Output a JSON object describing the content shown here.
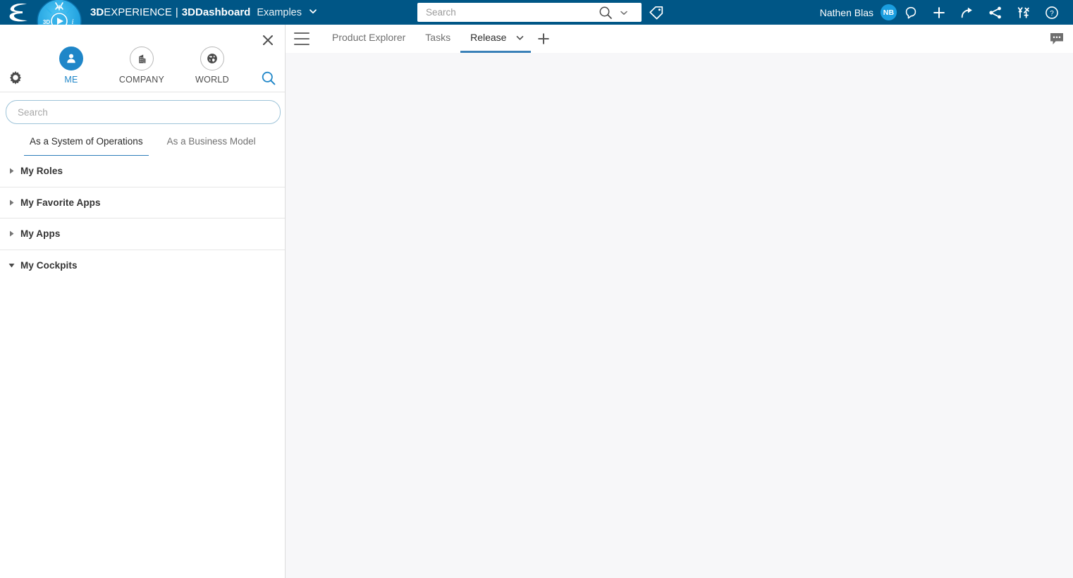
{
  "header": {
    "brand_bold_1": "3D",
    "brand_reg_1": "EXPERIENCE",
    "separator": "|",
    "brand_bold_2": "3DD",
    "brand_reg_2": "ashboard",
    "dashboard_name": "Examples",
    "dashboard_caret": "chevron-down-icon",
    "search": {
      "placeholder": "Search",
      "value": "",
      "magnifier_icon": "search-icon",
      "caret_icon": "chevron-down-icon"
    },
    "tag_icon": "tag-icon",
    "user_name": "Nathen Blas",
    "avatar_initials": "NB",
    "icons": [
      {
        "name": "notification-icon",
        "label": "Notifications"
      },
      {
        "name": "add-icon",
        "label": "Add"
      },
      {
        "name": "share-arrow-icon",
        "label": "Share"
      },
      {
        "name": "share-network-icon",
        "label": "Collaborate"
      },
      {
        "name": "swym-icon",
        "label": "3DSwym"
      },
      {
        "name": "help-icon",
        "label": "Help"
      }
    ],
    "bg_color": "#005686",
    "avatar_color": "#1a9ee0"
  },
  "left_panel": {
    "close_icon": "close-icon",
    "gear_icon": "gear-icon",
    "magnifier_icon": "search-icon",
    "segments": [
      {
        "label": "ME",
        "icon": "person-icon",
        "active": true
      },
      {
        "label": "COMPANY",
        "icon": "building-icon",
        "active": false
      },
      {
        "label": "WORLD",
        "icon": "globe-icon",
        "active": false
      }
    ],
    "search": {
      "placeholder": "Search",
      "value": ""
    },
    "tabs": [
      {
        "label": "As a System of Operations",
        "active": true
      },
      {
        "label": "As a Business Model",
        "active": false
      }
    ],
    "accordion": [
      {
        "label": "My Roles",
        "expanded": false,
        "arrow": "triangle-right-icon"
      },
      {
        "label": "My Favorite Apps",
        "expanded": false,
        "arrow": "triangle-right-icon"
      },
      {
        "label": "My Apps",
        "expanded": false,
        "arrow": "triangle-right-icon"
      },
      {
        "label": "My Cockpits",
        "expanded": true,
        "arrow": "triangle-down-icon"
      }
    ],
    "accent_color": "#2e7dbb"
  },
  "main": {
    "menu_icon": "hamburger-icon",
    "tabs": [
      {
        "label": "Product Explorer",
        "active": false
      },
      {
        "label": "Tasks",
        "active": false
      },
      {
        "label": "Release",
        "active": true,
        "caret": "chevron-down-icon"
      }
    ],
    "add_tab_icon": "plus-icon",
    "comment_icon": "comment-icon",
    "active_tab_color": "#3a81b8",
    "canvas_bg": "#f7f7f9"
  }
}
